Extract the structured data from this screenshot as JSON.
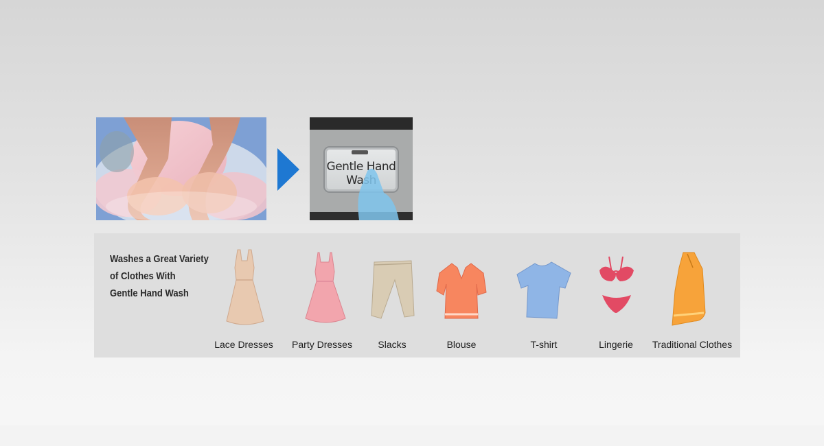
{
  "hero": {
    "hand_wash_photo": "hand-washing-photo",
    "arrow_color": "#1e78d2",
    "button_label_line1": "Gentle Hand",
    "button_label_line2": "Wash"
  },
  "variety": {
    "headline_line1": "Washes a Great Variety",
    "headline_line2": "of Clothes With",
    "headline_line3": "Gentle Hand Wash",
    "items": [
      {
        "label": "Lace Dresses",
        "color": "#e8c9b0"
      },
      {
        "label": "Party Dresses",
        "color": "#f2a5ad"
      },
      {
        "label": "Slacks",
        "color": "#d9ccb4"
      },
      {
        "label": "Blouse",
        "color": "#f7865f"
      },
      {
        "label": "T-shirt",
        "color": "#8fb5e6"
      },
      {
        "label": "Lingerie",
        "color": "#e24a64"
      },
      {
        "label": "Traditional Clothes",
        "color": "#f7a33a"
      }
    ]
  }
}
